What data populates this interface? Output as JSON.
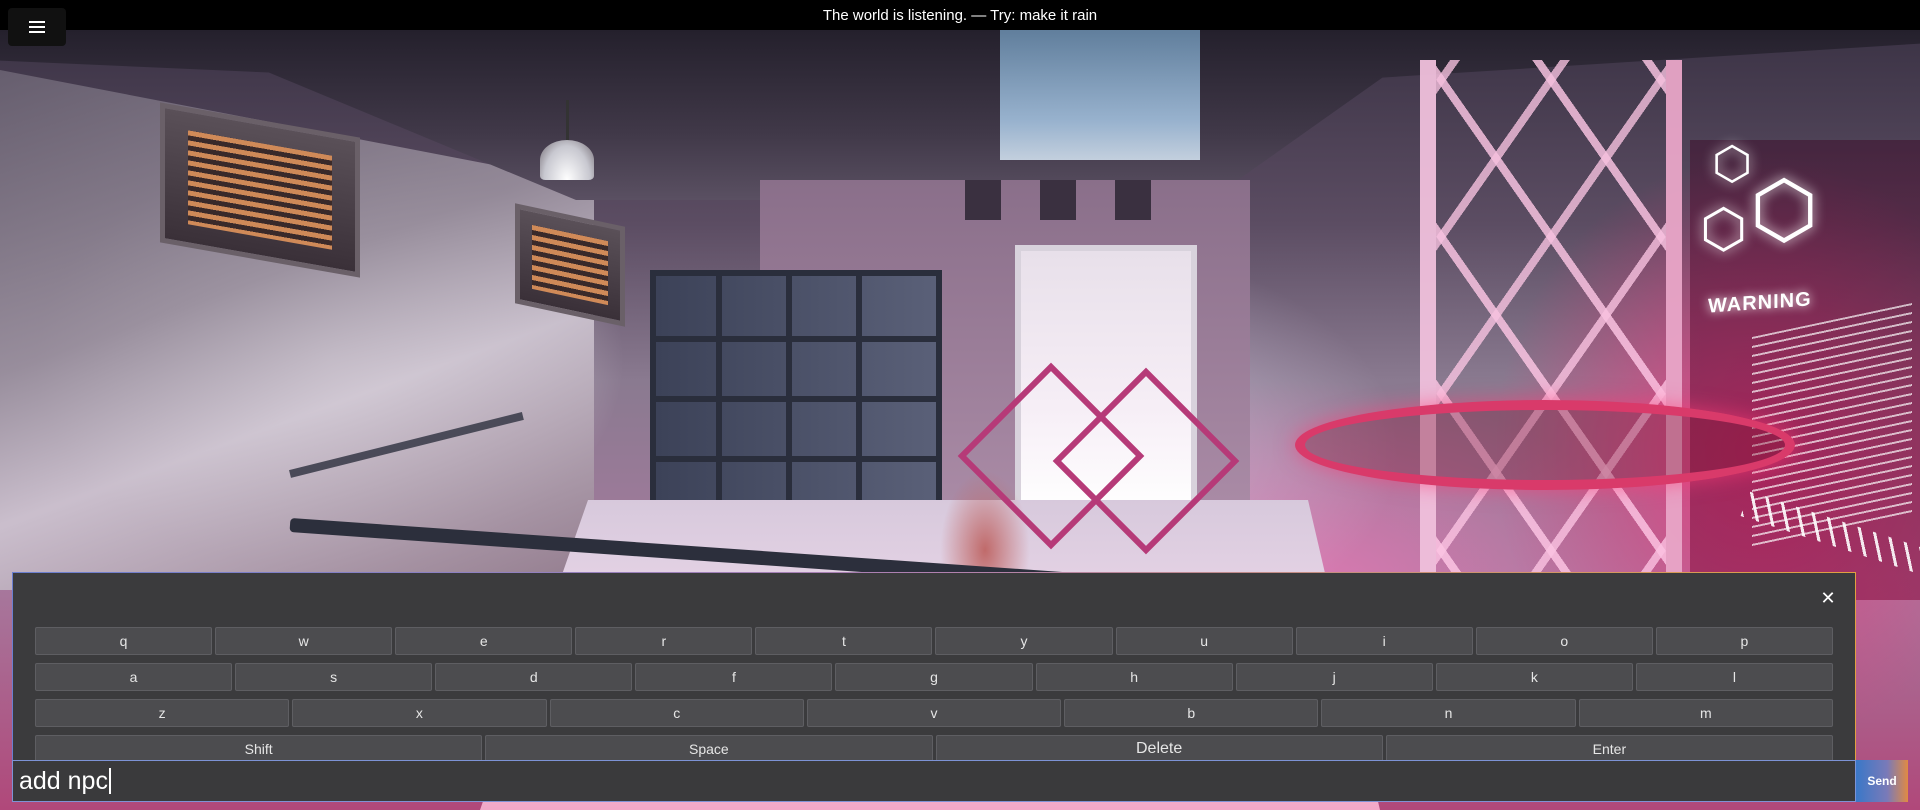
{
  "topbar": {
    "message": "The world is listening. — Try: make it rain",
    "menu_icon": "hamburger-menu-icon"
  },
  "scene": {
    "sign_text": "WARNING",
    "accent_colors": {
      "neon_pink": "#ff2878",
      "truss": "#f0c0dc",
      "ring": "#d93a6a"
    }
  },
  "keyboard": {
    "close_icon": "close-icon",
    "rows": [
      [
        "q",
        "w",
        "e",
        "r",
        "t",
        "y",
        "u",
        "i",
        "o",
        "p"
      ],
      [
        "a",
        "s",
        "d",
        "f",
        "g",
        "h",
        "j",
        "k",
        "l"
      ],
      [
        "z",
        "x",
        "c",
        "v",
        "b",
        "n",
        "m"
      ]
    ],
    "controls": {
      "shift": "Shift",
      "space": "Space",
      "delete": "Delete",
      "enter": "Enter"
    }
  },
  "input": {
    "value": "add npc",
    "send_label": "Send"
  },
  "colors": {
    "keyboard_bg": "#3b3b3d",
    "key_bg": "#4c4c4f",
    "input_border": "#7d93d6"
  }
}
